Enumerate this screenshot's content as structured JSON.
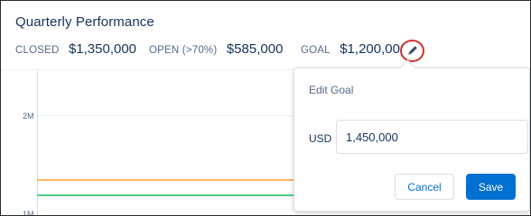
{
  "card": {
    "title": "Quarterly Performance"
  },
  "metrics": {
    "closed": {
      "label": "CLOSED",
      "value": "$1,350,000"
    },
    "open": {
      "label": "OPEN (>70%)",
      "value": "$585,000"
    },
    "goal": {
      "label": "GOAL",
      "value": "$1,200,000"
    }
  },
  "edit_icon": "pencil-icon",
  "chart": {
    "y_ticks": [
      "2M",
      "1M"
    ],
    "colors": {
      "closed": "#4bca81",
      "goal": "#ffb75d",
      "axis": "#d8dde6"
    }
  },
  "popover": {
    "title": "Edit Goal",
    "currency": "USD",
    "input_value": "1,450,000",
    "cancel_label": "Cancel",
    "save_label": "Save"
  },
  "colors": {
    "brand": "#0070d2",
    "text_primary": "#16325c",
    "text_secondary": "#54698d",
    "highlight_ring": "#d0322d"
  }
}
